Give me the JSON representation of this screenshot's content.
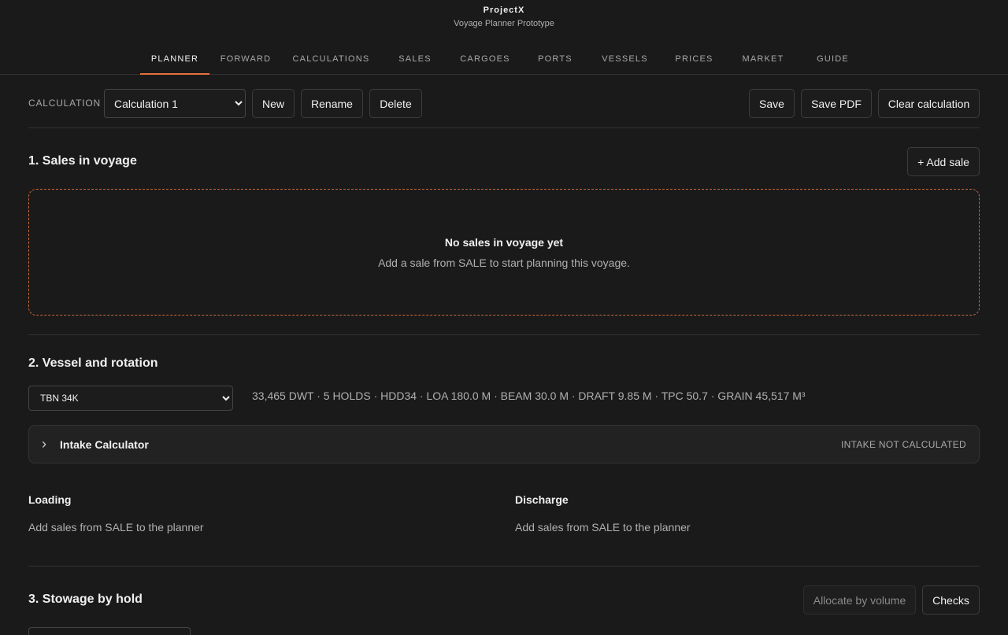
{
  "header": {
    "title": "ProjectX",
    "subtitle": "Voyage Planner Prototype"
  },
  "nav": {
    "tabs": [
      "PLANNER",
      "FORWARD",
      "CALCULATIONS",
      "SALES",
      "CARGOES",
      "PORTS",
      "VESSELS",
      "PRICES",
      "MARKET",
      "GUIDE"
    ],
    "active": "PLANNER"
  },
  "toolbar": {
    "calc_label": "CALCULATION",
    "calc_selected": "Calculation 1",
    "new_label": "New",
    "rename_label": "Rename",
    "delete_label": "Delete",
    "save_label": "Save",
    "save_pdf_label": "Save PDF",
    "clear_label": "Clear calculation"
  },
  "sales": {
    "title": "1. Sales in voyage",
    "add_label": "+ Add sale",
    "empty_title": "No sales in voyage yet",
    "empty_text": "Add a sale from SALE to start planning this voyage."
  },
  "vessel": {
    "title": "2. Vessel and rotation",
    "selected": "TBN 34K",
    "specs": "33,465 DWT · 5 HOLDS · HDD34 · LOA 180.0 M · BEAM 30.0 M · DRAFT 9.85 M · TPC 50.7 · GRAIN 45,517 M³",
    "intake_title": "Intake Calculator",
    "intake_status": "INTAKE NOT CALCULATED",
    "loading_title": "Loading",
    "loading_text": "Add sales from SALE to the planner",
    "discharge_title": "Discharge",
    "discharge_text": "Add sales from SALE to the planner"
  },
  "stowage": {
    "title": "3. Stowage by hold",
    "allocate_label": "Allocate by volume",
    "checks_label": "Checks"
  },
  "colors": {
    "background": "#1a1a1a",
    "accent": "#e8703a"
  }
}
